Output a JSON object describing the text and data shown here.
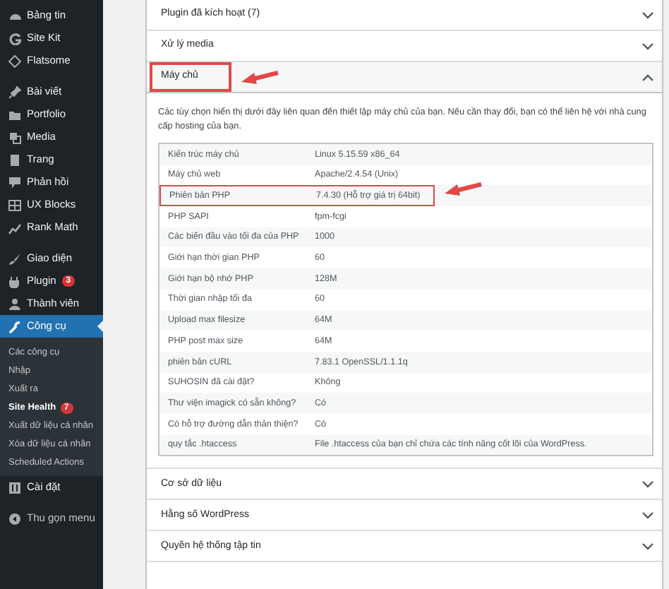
{
  "sidebar": {
    "groups": [
      [
        {
          "label": "Bảng tin",
          "current": false
        },
        {
          "label": "Site Kit",
          "current": false
        },
        {
          "label": "Flatsome",
          "current": false
        }
      ],
      [
        {
          "label": "Bài viết",
          "current": false
        },
        {
          "label": "Portfolio",
          "current": false
        },
        {
          "label": "Media",
          "current": false
        },
        {
          "label": "Trang",
          "current": false
        },
        {
          "label": "Phản hồi",
          "current": false
        },
        {
          "label": "UX Blocks",
          "current": false
        },
        {
          "label": "Rank Math",
          "current": false
        }
      ],
      [
        {
          "label": "Giao diện",
          "current": false
        },
        {
          "label": "Plugin",
          "current": false,
          "badge": "3"
        },
        {
          "label": "Thành viên",
          "current": false
        },
        {
          "label": "Công cụ",
          "current": true,
          "submenu": [
            {
              "label": "Các công cụ",
              "selected": false
            },
            {
              "label": "Nhập",
              "selected": false
            },
            {
              "label": "Xuất ra",
              "selected": false
            },
            {
              "label": "Site Health",
              "selected": true,
              "badge": "7"
            },
            {
              "label": "Xuất dữ liệu cá nhân",
              "selected": false
            },
            {
              "label": "Xóa dữ liệu cá nhân",
              "selected": false
            },
            {
              "label": "Scheduled Actions",
              "selected": false
            }
          ]
        },
        {
          "label": "Cài đặt",
          "current": false
        }
      ]
    ],
    "collapse": "Thu gọn menu"
  },
  "sections": [
    {
      "title": "Plugin đã kích hoạt (7)",
      "expanded": false,
      "annotated": false
    },
    {
      "title": "Xử lý media",
      "expanded": false,
      "annotated": false
    },
    {
      "title": "Máy chủ",
      "expanded": true,
      "annotated": true,
      "description": "Các tùy chọn hiển thị dưới đây liên quan đến thiết lập máy chủ của bạn. Nếu cần thay đổi, bạn có thể liên hệ với nhà cung cấp hosting của bạn.",
      "rows": [
        {
          "label": "Kiến trúc máy chủ",
          "value": "Linux 5.15.59 x86_64",
          "annotated": false
        },
        {
          "label": "Máy chủ web",
          "value": "Apache/2.4.54 (Unix)",
          "annotated": false
        },
        {
          "label": "Phiên bản PHP",
          "value": "7.4.30 (Hỗ trợ giá trị 64bit)",
          "annotated": true
        },
        {
          "label": "PHP SAPI",
          "value": "fpm-fcgi",
          "annotated": false
        },
        {
          "label": "Các biến đầu vào tối đa của PHP",
          "value": "1000",
          "annotated": false
        },
        {
          "label": "Giới hạn thời gian PHP",
          "value": "60",
          "annotated": false
        },
        {
          "label": "Giới hạn bộ nhớ PHP",
          "value": "128M",
          "annotated": false
        },
        {
          "label": "Thời gian nhập tối đa",
          "value": "60",
          "annotated": false
        },
        {
          "label": "Upload max filesize",
          "value": "64M",
          "annotated": false
        },
        {
          "label": "PHP post max size",
          "value": "64M",
          "annotated": false
        },
        {
          "label": "phiên bản cURL",
          "value": "7.83.1 OpenSSL/1.1.1q",
          "annotated": false
        },
        {
          "label": "SUHOSIN đã cài đặt?",
          "value": "Không",
          "annotated": false
        },
        {
          "label": "Thư viện imagick có sẵn không?",
          "value": "Có",
          "annotated": false
        },
        {
          "label": "Có hỗ trợ đường dẫn thân thiện?",
          "value": "Có",
          "annotated": false
        },
        {
          "label": "quy tắc .htaccess",
          "value": "File .htaccess của bạn chỉ chứa các tính năng cốt lõi của WordPress.",
          "annotated": false
        }
      ]
    },
    {
      "title": "Cơ sở dữ liệu",
      "expanded": false,
      "annotated": false
    },
    {
      "title": "Hằng số WordPress",
      "expanded": false,
      "annotated": false
    },
    {
      "title": "Quyền hệ thống tập tin",
      "expanded": false,
      "annotated": false
    }
  ]
}
